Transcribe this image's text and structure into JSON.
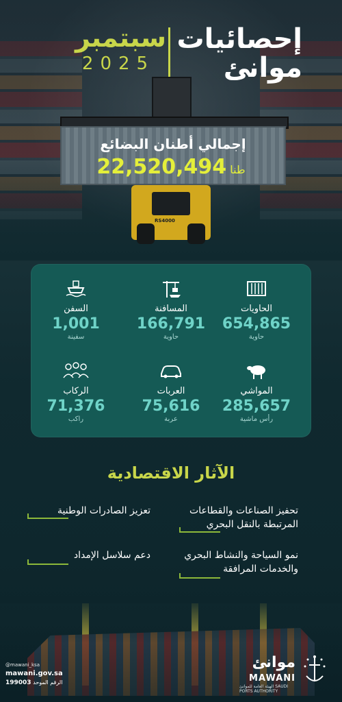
{
  "header": {
    "title_line1": "إحصائيات",
    "title_line2": "موانئ",
    "month": "سبتمبر",
    "year": "2025"
  },
  "cargo": {
    "label": "إجمالي أطنان البضائع",
    "value": "22,520,494",
    "unit": "طنا"
  },
  "truck_plate": "RS4000",
  "stats": [
    {
      "label": "الحاويات",
      "value": "654,865",
      "unit": "حاوية",
      "icon": "container-icon"
    },
    {
      "label": "المسافنة",
      "value": "166,791",
      "unit": "حاوية",
      "icon": "crane-ship-icon"
    },
    {
      "label": "السفن",
      "value": "1,001",
      "unit": "سفينة",
      "icon": "ship-icon"
    },
    {
      "label": "المواشي",
      "value": "285,657",
      "unit": "رأس ماشية",
      "icon": "sheep-icon"
    },
    {
      "label": "العربات",
      "value": "75,616",
      "unit": "عربة",
      "icon": "car-icon"
    },
    {
      "label": "الركاب",
      "value": "71,376",
      "unit": "راكب",
      "icon": "passengers-icon"
    }
  ],
  "effects": {
    "title": "الآثار الاقتصادية",
    "items": [
      "تحفيز الصناعات والقطاعات المرتبطة بالنقل البحري",
      "تعزيز الصادرات الوطنية",
      "نمو السياحة والنشاط البحري والخدمات المرافقة",
      "دعم سلاسل الإمداد"
    ]
  },
  "footer": {
    "social": "@mawani_ksa",
    "website": "mawani.gov.sa",
    "unified_label": "الرقم الموحد",
    "unified_number": "199003"
  },
  "logo": {
    "arabic": "موانئ",
    "english": "MAWANI",
    "sub_ar": "الهيئة العامة للموانئ",
    "sub_en": "SAUDI PORTS AUTHORITY"
  },
  "colors": {
    "accent_yellow": "#c8d64a",
    "value_teal": "#6fd3c8",
    "panel": "#155a55",
    "background": "#0f2a30"
  }
}
